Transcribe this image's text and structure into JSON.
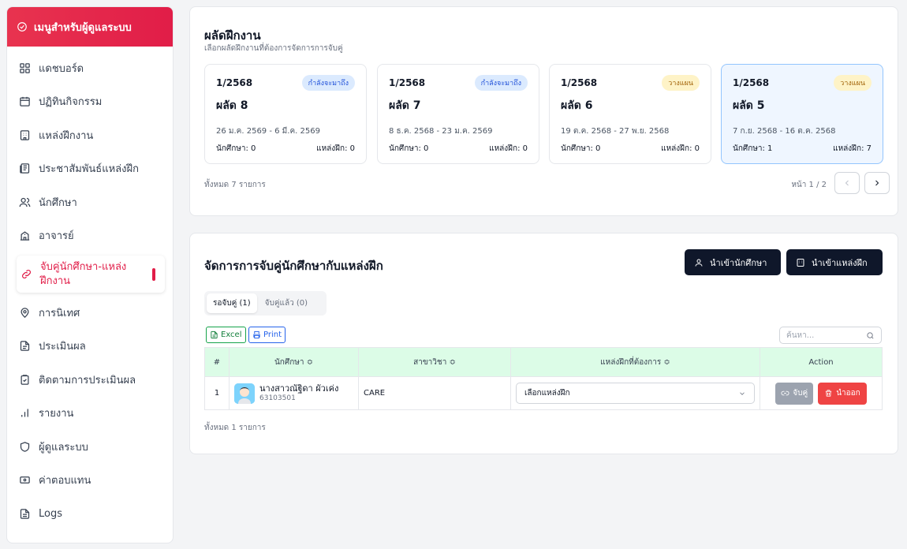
{
  "sidebar": {
    "title": "เมนูสำหรับผู้ดูแลระบบ",
    "items": [
      {
        "label": "แดชบอร์ด",
        "icon": "dashboard-icon"
      },
      {
        "label": "ปฏิทินกิจกรรม",
        "icon": "calendar-icon"
      },
      {
        "label": "แหล่งฝึกงาน",
        "icon": "building-icon"
      },
      {
        "label": "ประชาสัมพันธ์แหล่งฝึก",
        "icon": "news-icon"
      },
      {
        "label": "นักศึกษา",
        "icon": "users-icon"
      },
      {
        "label": "อาจารย์",
        "icon": "school-icon"
      },
      {
        "label": "จับคู่นักศึกษา-แหล่งฝึกงาน",
        "icon": "link-icon",
        "active": true
      },
      {
        "label": "การนิเทศ",
        "icon": "location-icon"
      },
      {
        "label": "ประเมินผล",
        "icon": "document-icon"
      },
      {
        "label": "ติดตามการประเมินผล",
        "icon": "clipboard-check-icon"
      },
      {
        "label": "รายงาน",
        "icon": "bar-chart-icon"
      },
      {
        "label": "ผู้ดูแลระบบ",
        "icon": "shield-icon"
      },
      {
        "label": "ค่าตอบแทน",
        "icon": "banknote-icon"
      },
      {
        "label": "Logs",
        "icon": "file-text-icon"
      }
    ]
  },
  "batches": {
    "title": "ผลัดฝึกงาน",
    "subtitle": "เลือกผลัดฝึกงานที่ต้องการจัดการการจับคู่",
    "items": [
      {
        "term": "1/2568",
        "badge": "กำลังจะมาถึง",
        "badge_color": "blue",
        "name": "ผลัด 8",
        "dates": "26 ม.ค. 2569 - 6 มี.ค. 2569",
        "students": "นักศึกษา: 0",
        "places": "แหล่งฝึก: 0"
      },
      {
        "term": "1/2568",
        "badge": "กำลังจะมาถึง",
        "badge_color": "blue",
        "name": "ผลัด 7",
        "dates": "8 ธ.ค. 2568 - 23 ม.ค. 2569",
        "students": "นักศึกษา: 0",
        "places": "แหล่งฝึก: 0"
      },
      {
        "term": "1/2568",
        "badge": "วางแผน",
        "badge_color": "yellow",
        "name": "ผลัด 6",
        "dates": "19 ต.ค. 2568 - 27 พ.ย. 2568",
        "students": "นักศึกษา: 0",
        "places": "แหล่งฝึก: 0"
      },
      {
        "term": "1/2568",
        "badge": "วางแผน",
        "badge_color": "yellow",
        "name": "ผลัด 5",
        "dates": "7 ก.ย. 2568 - 16 ต.ค. 2568",
        "students": "นักศึกษา: 1",
        "places": "แหล่งฝึก: 7",
        "selected": true
      }
    ],
    "total": "ทั้งหมด 7 รายการ",
    "page_info": "หน้า 1 / 2"
  },
  "matching": {
    "title": "จัดการการจับคู่นักศึกษากับแหล่งฝึก",
    "import_students": "นำเข้านักศึกษา",
    "import_places": "นำเข้าแหล่งฝึก",
    "tab_waiting": "รอจับคู่ (1)",
    "tab_paired": "จับคู่แล้ว (0)",
    "excel": "Excel",
    "print": "Print",
    "search_placeholder": "ค้นหา...",
    "columns": [
      "#",
      "นักศึกษา ≎",
      "สาขาวิชา ≎",
      "แหล่งฝึกที่ต้องการ ≎",
      "Action"
    ],
    "rows": [
      {
        "no": "1",
        "name": "นางสาวณัฐิดา ผัวเค่ง",
        "id": "63103501",
        "major": "CARE",
        "place": "เลือกแหล่งฝึก"
      }
    ],
    "pair_label": "จับคู่",
    "remove_label": "นำออก",
    "total": "ทั้งหมด 1 รายการ"
  },
  "colors": {
    "accent": "#e11d48",
    "dark_button": "#0f172a",
    "table_header": "#dcfce7"
  }
}
